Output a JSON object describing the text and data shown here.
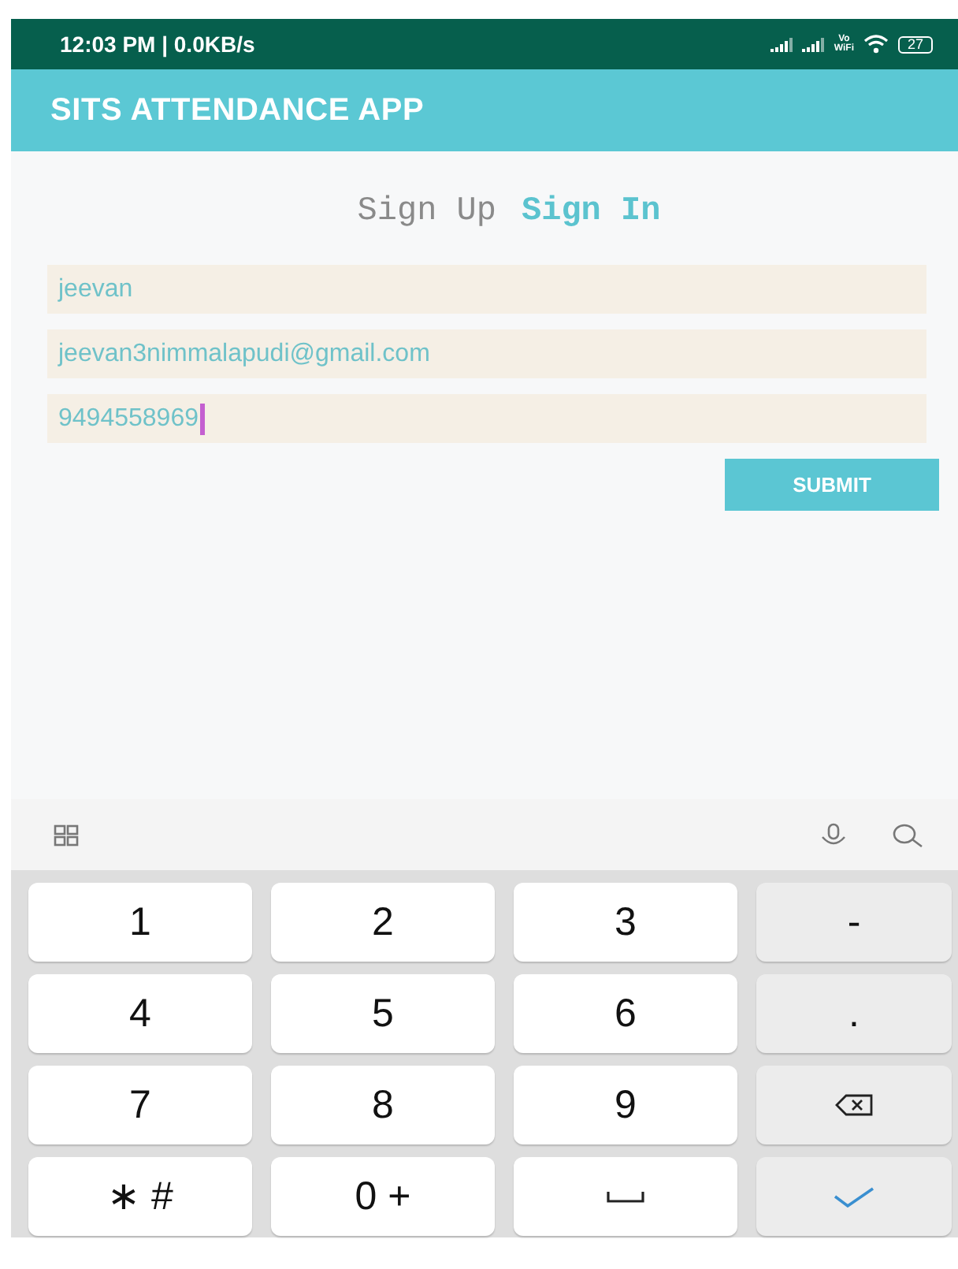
{
  "status_bar": {
    "time": "12:03 PM | 0.0KB/s",
    "vo": "Vo",
    "wifi": "WiFi",
    "battery": "27"
  },
  "app_bar": {
    "title": "SITS ATTENDANCE APP"
  },
  "tabs": [
    {
      "label": "Sign Up",
      "selected": false
    },
    {
      "label": "Sign In",
      "selected": true
    }
  ],
  "fields": [
    {
      "value": "jeevan",
      "focused": false
    },
    {
      "value": "jeevan3nimmalapudi@gmail.com",
      "focused": false
    },
    {
      "value": "9494558969",
      "focused": true
    }
  ],
  "submit": "SUBMIT",
  "keyboard": {
    "keys": [
      {
        "kind": "digit",
        "label": "1"
      },
      {
        "kind": "digit",
        "label": "2"
      },
      {
        "kind": "digit",
        "label": "3"
      },
      {
        "kind": "symbol",
        "label": "-"
      },
      {
        "kind": "digit",
        "label": "4"
      },
      {
        "kind": "digit",
        "label": "5"
      },
      {
        "kind": "digit",
        "label": "6"
      },
      {
        "kind": "symbol",
        "label": "."
      },
      {
        "kind": "digit",
        "label": "7"
      },
      {
        "kind": "digit",
        "label": "8"
      },
      {
        "kind": "digit",
        "label": "9"
      },
      {
        "kind": "backspace"
      },
      {
        "kind": "digit",
        "label": "∗ #"
      },
      {
        "kind": "digit",
        "label": "0 +"
      },
      {
        "kind": "space"
      },
      {
        "kind": "enter"
      }
    ]
  }
}
